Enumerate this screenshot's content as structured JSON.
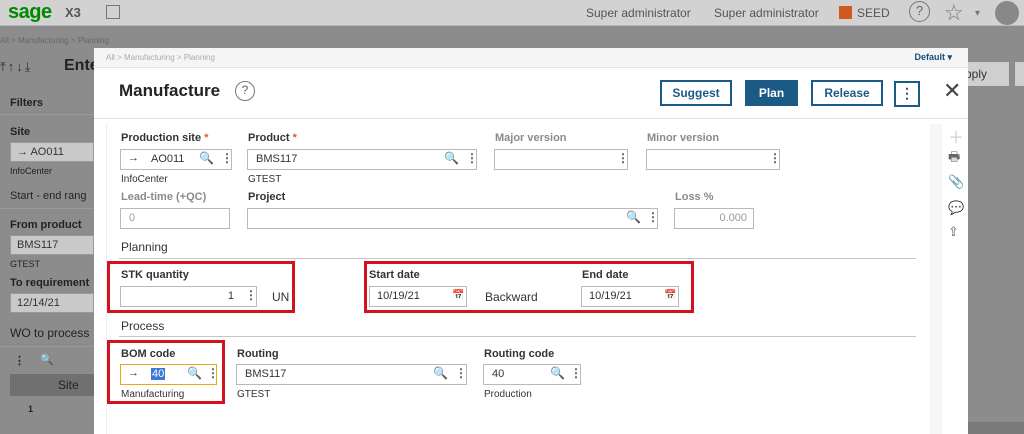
{
  "topbar": {
    "logo": "sage",
    "product": "X3",
    "user1": "Super administrator",
    "user2": "Super administrator",
    "folder": "SEED",
    "help_icon": "?",
    "star_icon": "☆",
    "caret": "▾",
    "folder_color": "#d15a1e"
  },
  "background": {
    "breadcrumb": "All  >  Manufacturing  >  Planning",
    "arrows": "⤒↑↓⤓",
    "title": "Ente",
    "filters": "Filters",
    "site_label": "Site",
    "site_value": "→   AO011",
    "site_sub": "InfoCenter",
    "start_end": "Start - end rang",
    "from_product": "From product",
    "from_product_value": "BMS117",
    "from_product_sub": "GTEST",
    "to_requirement": "To requirement",
    "to_requirement_value": "12/14/21",
    "wo_to_process": "WO to process",
    "grid_site": "Site",
    "row_number": "1",
    "apply_btn": "pply"
  },
  "modal": {
    "breadcrumb": "All  >  Manufacturing  >  Planning",
    "default_label": "Default  ▾",
    "title": "Manufacture",
    "help": "?",
    "buttons": {
      "suggest": "Suggest",
      "plan": "Plan",
      "release": "Release",
      "more": "⋮"
    },
    "close": "✕"
  },
  "form": {
    "production_site": {
      "label": "Production site",
      "required": "*",
      "value": "AO011",
      "sub": "InfoCenter"
    },
    "product": {
      "label": "Product",
      "required": "*",
      "value": "BMS117",
      "sub": "GTEST"
    },
    "major_version": {
      "label": "Major version",
      "value": ""
    },
    "minor_version": {
      "label": "Minor version",
      "value": ""
    },
    "lead_time": {
      "label": "Lead-time (+QC)",
      "value": "0"
    },
    "project": {
      "label": "Project",
      "value": ""
    },
    "loss": {
      "label": "Loss %",
      "value": "0.000"
    },
    "planning_section": "Planning",
    "stk_quantity": {
      "label": "STK quantity",
      "value": "1",
      "unit": "UN"
    },
    "start_date": {
      "label": "Start date",
      "value": "10/19/21"
    },
    "scheduling": "Backward",
    "end_date": {
      "label": "End date",
      "value": "10/19/21"
    },
    "process_section": "Process",
    "bom_code": {
      "label": "BOM code",
      "value": "40",
      "sub": "Manufacturing"
    },
    "routing": {
      "label": "Routing",
      "value": "BMS117",
      "sub": "GTEST"
    },
    "routing_code": {
      "label": "Routing code",
      "value": "40",
      "sub": "Production"
    }
  },
  "icons": {
    "arrow": "→",
    "search": "🔍",
    "dots": "⋮",
    "calendar": "📅"
  },
  "colors": {
    "accent": "#1c5a86",
    "highlight_red": "#d4121f",
    "brand_green": "#008a00"
  }
}
